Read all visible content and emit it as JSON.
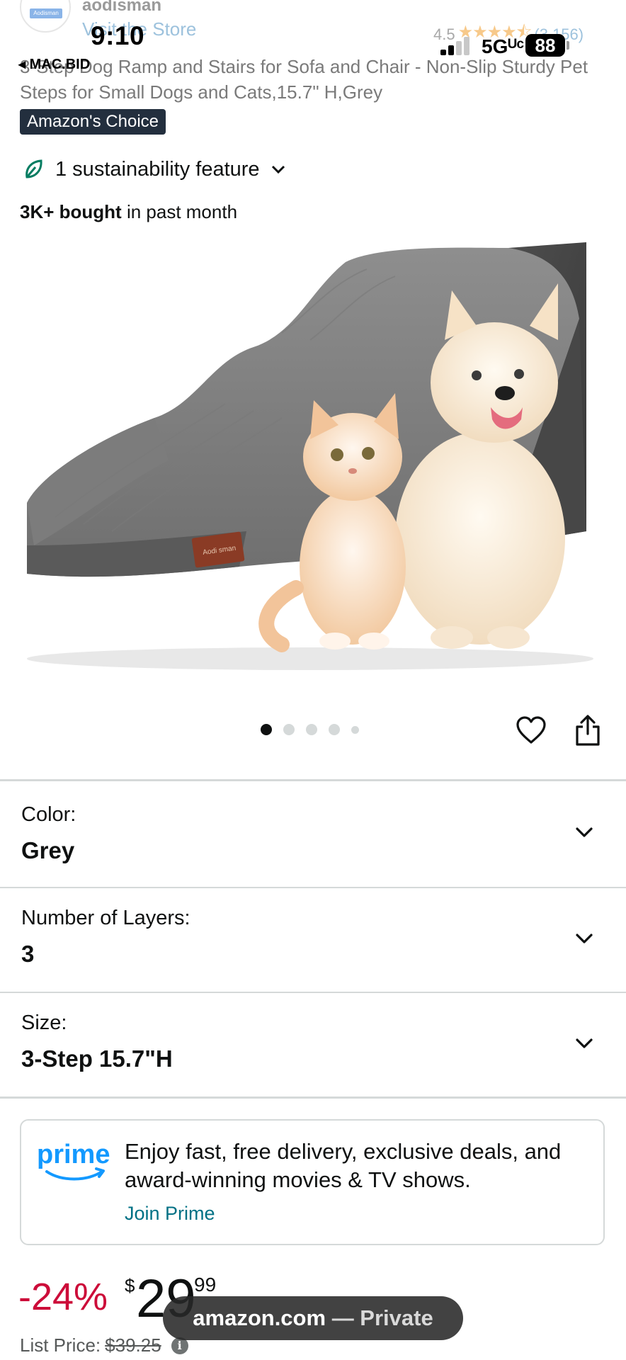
{
  "status_bar": {
    "time": "9:10",
    "back_app": "◂ MAC.BID",
    "network": "5Gᵁᶜ",
    "battery": "88"
  },
  "store": {
    "logo_text": "Aodisman",
    "brand_name": "aodisman",
    "visit_label": "Visit the Store"
  },
  "rating": {
    "value": "4.5",
    "stars": "★★★★⯪",
    "count": "(3,156)"
  },
  "product": {
    "title": "3-Step Dog Ramp and Stairs for Sofa and Chair - Non-Slip Sturdy Pet Steps for Small Dogs and Cats,15.7\" H,Grey",
    "badge": "Amazon's Choice",
    "sustainability": "1 sustainability feature",
    "bought_bold": "3K+ bought",
    "bought_rest": " in past month",
    "image_tag": "Aodi sman",
    "image_count": 5,
    "active_image": 1
  },
  "variations": [
    {
      "label": "Color:",
      "value": "Grey"
    },
    {
      "label": "Number of Layers:",
      "value": "3"
    },
    {
      "label": "Size:",
      "value": "3-Step 15.7\"H"
    }
  ],
  "prime": {
    "logo": "prime",
    "text": "Enjoy fast, free delivery, exclusive deals, and award-winning movies & TV shows.",
    "link": "Join Prime"
  },
  "price": {
    "discount": "-24%",
    "symbol": "$",
    "whole": "29",
    "fraction": "99",
    "list_label": "List Price:",
    "list_value": "$39.25"
  },
  "browser": {
    "domain": "amazon.com",
    "mode": "— Private"
  },
  "colors": {
    "discount_red": "#cc0c39",
    "link_teal": "#007185",
    "prime_blue": "#1399ff",
    "badge_navy": "#232f3e",
    "leaf_green": "#067d62"
  }
}
